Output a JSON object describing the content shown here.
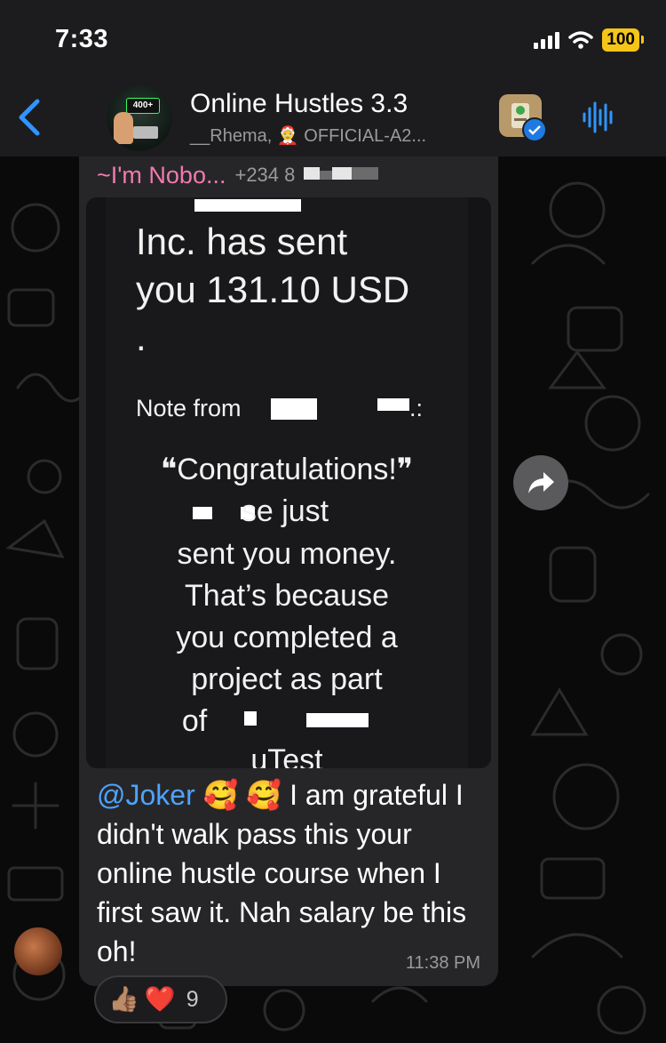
{
  "status_bar": {
    "time": "7:33",
    "battery": "100"
  },
  "header": {
    "back_icon": "chevron-left-icon",
    "group_avatar_badge": "400+",
    "title": "Online Hustles 3.3",
    "members": "__Rhema,  🤶 OFFICIAL-A2...",
    "sticker_icon": "sticker-icon",
    "voice_icon": "audio-wave-icon"
  },
  "message": {
    "sender_name": "~I'm Nobo...",
    "sender_phone": "+234 8",
    "photo": {
      "line1": "Inc. has sent",
      "line2": "you 131.10 USD",
      "line3": ".",
      "note_prefix": "Note from",
      "note_suffix": ".:",
      "quote_open": "❝Congratulations!❞",
      "quote2": "se just",
      "quote3": "sent you money.",
      "quote4": "That’s because",
      "quote5": "you completed a",
      "quote6": "project as part",
      "quote7": "of",
      "quote8": "uTest"
    },
    "mention": "@Joker",
    "emoji": "🥰 🥰",
    "text": "I am grateful I didn't walk pass this your online hustle course when I first saw it. Nah salary be this oh!",
    "time": "11:38 PM"
  },
  "reactions": {
    "emojis": [
      "👍🏽",
      "❤️"
    ],
    "count": "9"
  },
  "colors": {
    "sender": "#f07ab0",
    "mention": "#4da3ff",
    "bubble": "#262628",
    "battery": "#f5c518"
  }
}
